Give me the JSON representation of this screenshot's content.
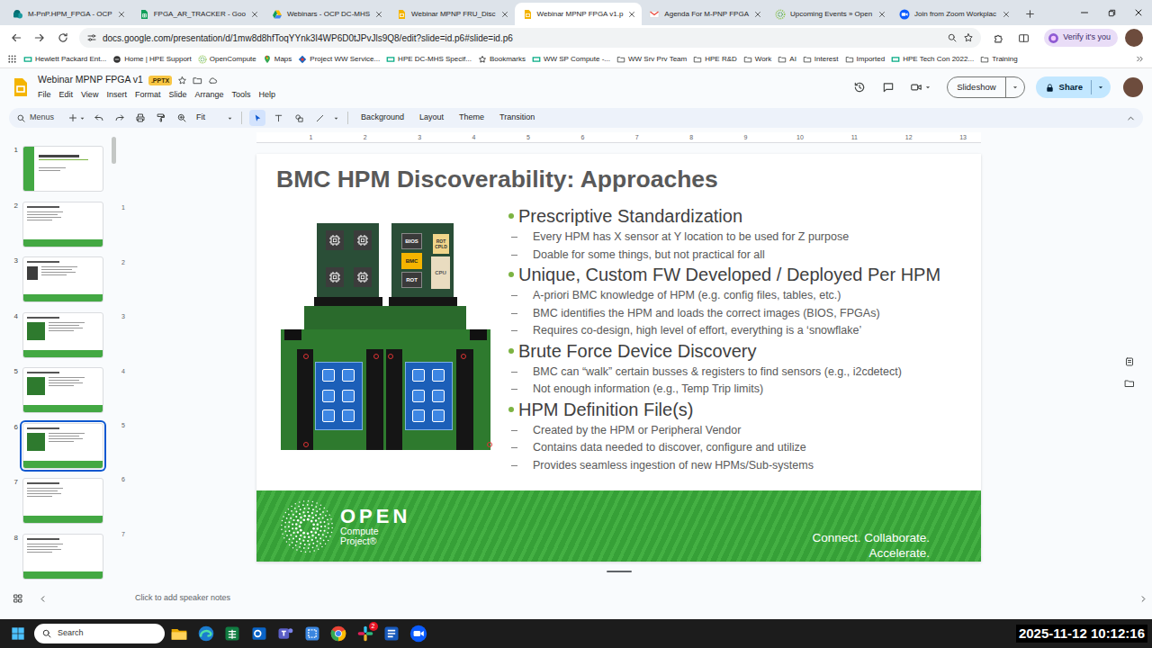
{
  "browser": {
    "tabs": [
      {
        "label": "M-PnP.HPM_FPGA - OCP",
        "kind": "sharepoint",
        "selected": false
      },
      {
        "label": "FPGA_AR_TRACKER - Goo",
        "kind": "sheets",
        "selected": false
      },
      {
        "label": "Webinars - OCP DC-MHS",
        "kind": "drive",
        "selected": false
      },
      {
        "label": "Webinar MPNP FRU_Disc",
        "kind": "slides",
        "selected": false
      },
      {
        "label": "Webinar MPNP FPGA v1.p",
        "kind": "slides",
        "selected": true
      },
      {
        "label": "Agenda For M-PNP FPGA",
        "kind": "gmail",
        "selected": false
      },
      {
        "label": "Upcoming Events » Open",
        "kind": "ocp",
        "selected": false
      },
      {
        "label": "Join from Zoom Workplac",
        "kind": "zoom",
        "selected": false
      }
    ],
    "url": "docs.google.com/presentation/d/1mw8d8hfToqYYnk3I4WP6D0tJPvJls9Q8/edit?slide=id.p6#slide=id.p6",
    "verify": "Verify it's you",
    "bookmarks": [
      {
        "label": "Hewlett Packard Ent...",
        "kind": "hpe"
      },
      {
        "label": "Home | HPE Support",
        "kind": "support"
      },
      {
        "label": "OpenCompute",
        "kind": "ocp"
      },
      {
        "label": "Maps",
        "kind": "maps"
      },
      {
        "label": "Project WW Service...",
        "kind": "project"
      },
      {
        "label": "HPE DC-MHS Specif...",
        "kind": "hpe"
      },
      {
        "label": "Bookmarks",
        "kind": "star"
      },
      {
        "label": "WW SP Compute -...",
        "kind": "hpe"
      },
      {
        "label": "WW Srv Prv Team",
        "kind": "folder"
      },
      {
        "label": "HPE R&D",
        "kind": "folder"
      },
      {
        "label": "Work",
        "kind": "folder"
      },
      {
        "label": "AI",
        "kind": "folder"
      },
      {
        "label": "Interest",
        "kind": "folder"
      },
      {
        "label": "Imported",
        "kind": "folder"
      },
      {
        "label": "HPE Tech Con 2022...",
        "kind": "hpe"
      },
      {
        "label": "Training",
        "kind": "folder"
      }
    ]
  },
  "docs": {
    "title": "Webinar MPNP FPGA v1",
    "badge": ".PPTX",
    "menu": [
      "File",
      "Edit",
      "View",
      "Insert",
      "Format",
      "Slide",
      "Arrange",
      "Tools",
      "Help"
    ],
    "slideshow": "Slideshow",
    "share": "Share"
  },
  "toolbar": {
    "search": "Menus",
    "zoom": "Fit",
    "tools": [
      {
        "kind": "select",
        "selected": true
      },
      {
        "kind": "textbox",
        "selected": false
      },
      {
        "kind": "shape",
        "selected": false
      },
      {
        "kind": "line",
        "selected": false
      }
    ],
    "actions": [
      "Background",
      "Layout",
      "Theme",
      "Transition"
    ]
  },
  "filmstrip": [
    {
      "number": "1",
      "kind": "title",
      "selected": false
    },
    {
      "number": "2",
      "kind": "text",
      "selected": false
    },
    {
      "number": "3",
      "kind": "photo",
      "selected": false
    },
    {
      "number": "4",
      "kind": "diagram",
      "selected": false
    },
    {
      "number": "5",
      "kind": "diagram",
      "selected": false
    },
    {
      "number": "6",
      "kind": "diagram",
      "selected": true
    },
    {
      "number": "7",
      "kind": "text",
      "selected": false
    },
    {
      "number": "8",
      "kind": "text",
      "selected": false
    }
  ],
  "rulers": {
    "horizontal": [
      "1",
      "2",
      "3",
      "4",
      "5",
      "6",
      "7",
      "8",
      "9",
      "10",
      "11",
      "12",
      "13"
    ],
    "vertical": [
      "1",
      "2",
      "3",
      "4",
      "5",
      "6",
      "7"
    ]
  },
  "slide": {
    "title": "BMC HPM Discoverability: Approaches",
    "bullets": [
      {
        "text": "Prescriptive Standardization",
        "subs": [
          "Every HPM has X sensor at Y location to be used for Z purpose",
          "Doable for some things, but not practical for all"
        ]
      },
      {
        "text": "Unique, Custom FW Developed / Deployed Per HPM",
        "subs": [
          "A-priori BMC knowledge of HPM (e.g. config files, tables, etc.)",
          "BMC identifies the HPM and loads the correct images (BIOS, FPGAs)",
          "Requires co-design, high level of effort, everything is a ‘snowflake’"
        ]
      },
      {
        "text": "Brute Force Device Discovery",
        "subs": [
          "BMC can “walk” certain busses & registers to find sensors (e.g., i2cdetect)",
          "Not enough information (e.g., Temp Trip limits)"
        ]
      },
      {
        "text": "HPM Definition File(s)",
        "subs": [
          "Created by the HPM or Peripheral Vendor",
          "Contains data needed to discover, configure and utilize",
          "Provides seamless ingestion of new HPMs/Sub-systems"
        ]
      }
    ],
    "figure": {
      "chips": [
        {
          "label": "BIOS",
          "highlighted": false
        },
        {
          "label": "BMC",
          "highlighted": true
        },
        {
          "label": "ROT",
          "highlighted": false
        }
      ],
      "cpld": "ROT CPLD",
      "cpu": "CPU"
    },
    "footer": {
      "logo_open": "OPEN",
      "logo_line1": "Compute",
      "logo_line2": "Project®",
      "tagline": [
        "Connect. Collaborate.",
        "Accelerate."
      ]
    }
  },
  "notes": {
    "placeholder": "Click to add speaker notes"
  },
  "taskbar": {
    "search": "Search",
    "apps": [
      {
        "kind": "explorer"
      },
      {
        "kind": "edge"
      },
      {
        "kind": "excel"
      },
      {
        "kind": "outlook"
      },
      {
        "kind": "teams"
      },
      {
        "kind": "snip"
      },
      {
        "kind": "chrome"
      },
      {
        "kind": "slack",
        "badge": "2"
      },
      {
        "kind": "word"
      },
      {
        "kind": "zoom"
      }
    ],
    "clock": "2025-11-12 10:12:16"
  }
}
